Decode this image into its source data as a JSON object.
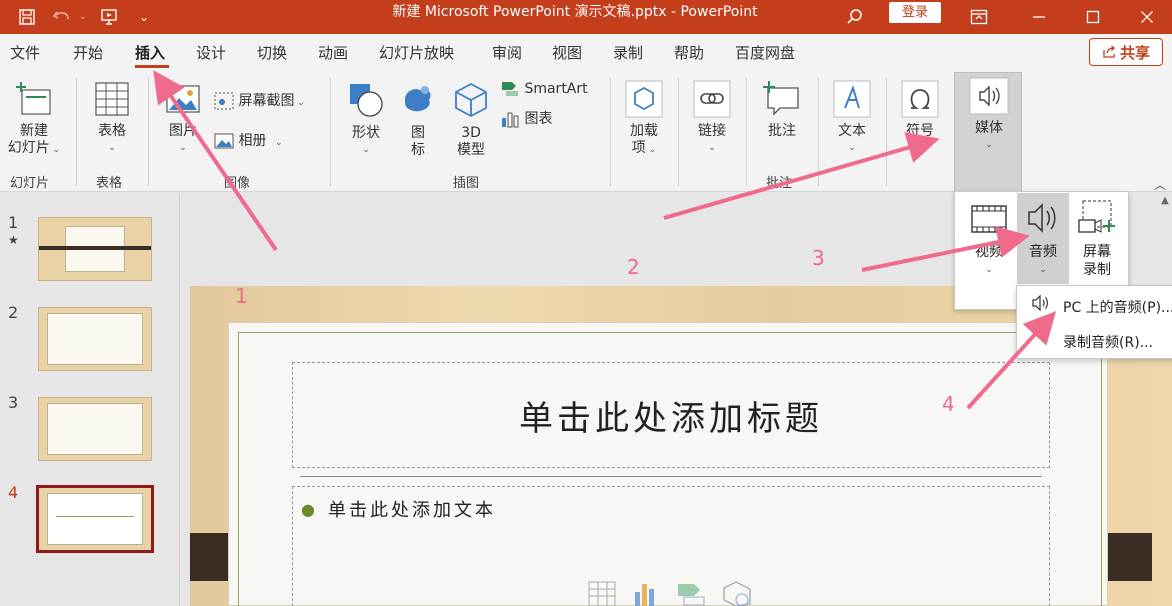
{
  "window": {
    "title": "新建 Microsoft PowerPoint 演示文稿.pptx  -  PowerPoint",
    "login_label": "登录"
  },
  "tabs": [
    {
      "label": "文件"
    },
    {
      "label": "开始"
    },
    {
      "label": "插入"
    },
    {
      "label": "设计"
    },
    {
      "label": "切换"
    },
    {
      "label": "动画"
    },
    {
      "label": "幻灯片放映"
    },
    {
      "label": "审阅"
    },
    {
      "label": "视图"
    },
    {
      "label": "录制"
    },
    {
      "label": "帮助"
    },
    {
      "label": "百度网盘"
    }
  ],
  "share_label": "共享",
  "ribbon": {
    "new_slide": {
      "line1": "新建",
      "line2": "幻灯片"
    },
    "table": "表格",
    "picture": "图片",
    "screenshot": "屏幕截图",
    "album": "相册",
    "shapes": "形状",
    "icons": {
      "line1": "图",
      "line2": "标"
    },
    "model3d": {
      "line1": "3D",
      "line2": "模型"
    },
    "smartart": "SmartArt",
    "chart": "图表",
    "addins": {
      "line1": "加载",
      "line2": "项"
    },
    "link": "链接",
    "comment": "批注",
    "text": "文本",
    "symbol": "符号",
    "media": "媒体",
    "groups": {
      "slides": "幻灯片",
      "tables": "表格",
      "images": "图像",
      "illustrations": "插图",
      "comments": "批注"
    }
  },
  "media_menu": {
    "video": "视频",
    "audio": "音频",
    "screen_record": {
      "line1": "屏幕",
      "line2": "录制"
    }
  },
  "audio_menu": {
    "pc_audio": "PC 上的音频(P)...",
    "record_audio": "录制音频(R)..."
  },
  "thumbnails": [
    {
      "num": "1",
      "star": "★"
    },
    {
      "num": "2"
    },
    {
      "num": "3"
    },
    {
      "num": "4"
    }
  ],
  "slide": {
    "title_placeholder": "单击此处添加标题",
    "body_placeholder": "单击此处添加文本"
  },
  "annotations": [
    "1",
    "2",
    "3",
    "4"
  ],
  "colors": {
    "accent": "#c43e1c",
    "annotation": "#f06a8c"
  }
}
